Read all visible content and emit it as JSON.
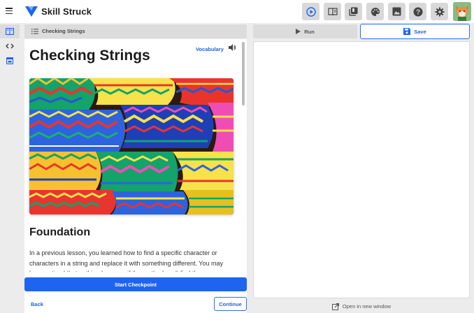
{
  "app": {
    "brand": "Skill Struck"
  },
  "toolbar": {
    "buttons": [
      {
        "icon": "play-circle-icon",
        "name": "run-toolbar-button"
      },
      {
        "icon": "book-icon",
        "name": "reader-toolbar-button"
      },
      {
        "icon": "library-icon",
        "name": "library-toolbar-button"
      },
      {
        "icon": "palette-icon",
        "name": "palette-toolbar-button"
      },
      {
        "icon": "image-icon",
        "name": "image-toolbar-button"
      },
      {
        "icon": "help-icon",
        "name": "help-toolbar-button"
      },
      {
        "icon": "gear-icon",
        "name": "settings-toolbar-button"
      }
    ],
    "accent": "#1e64f0"
  },
  "rail": {
    "items": [
      "lesson-book-icon",
      "code-icon",
      "browser-window-icon"
    ]
  },
  "lesson": {
    "header_label": "Checking Strings",
    "title": "Checking Strings",
    "vocabulary_label": "Vocabulary",
    "section_title": "Foundation",
    "paragraph": "In a previous lesson, you learned how to find a specific character or characters in a string and replace it with something different. You may have noticed that nothing happens if the method can't find the",
    "checkpoint_label": "Start Checkpoint",
    "back_label": "Back",
    "continue_label": "Continue"
  },
  "editor": {
    "run_label": "Run",
    "save_label": "Save",
    "open_new_label": "Open in new window"
  }
}
